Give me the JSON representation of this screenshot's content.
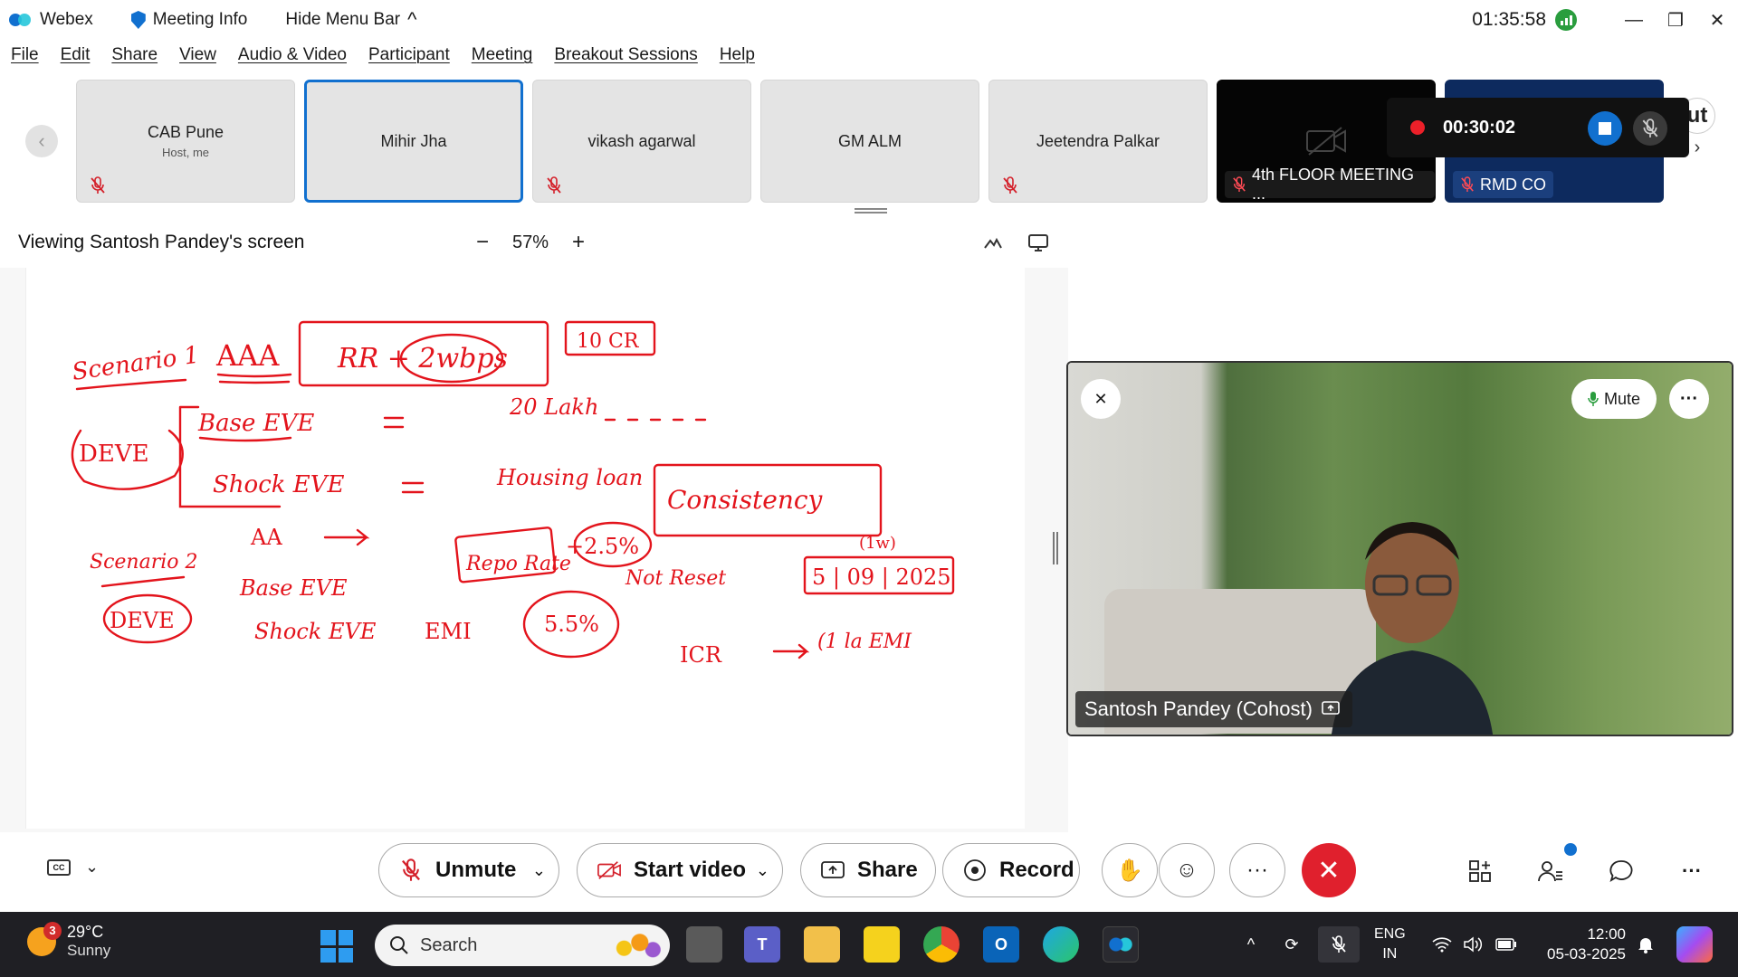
{
  "titlebar": {
    "app_name": "Webex",
    "meeting_info": "Meeting Info",
    "hide_menu": "Hide Menu Bar",
    "hide_menu_caret": "^",
    "clock": "01:35:58",
    "minimize": "—",
    "restore": "❐",
    "close": "✕"
  },
  "menu": [
    "File",
    "Edit",
    "Share",
    "View",
    "Audio & Video",
    "Participant",
    "Meeting",
    "Breakout Sessions",
    "Help"
  ],
  "participants": [
    {
      "name": "CAB Pune",
      "sub": "Host, me"
    },
    {
      "name": "Mihir Jha",
      "sub": ""
    },
    {
      "name": "vikash agarwal",
      "sub": ""
    },
    {
      "name": "GM ALM",
      "sub": ""
    },
    {
      "name": "Jeetendra Palkar",
      "sub": ""
    },
    {
      "name": "4th FLOOR MEETING ...",
      "sub": ""
    },
    {
      "name": "RMD CO",
      "sub": ""
    }
  ],
  "strip_nav": {
    "prev": "‹",
    "next_partial": "ut",
    "next_arrow": "›"
  },
  "recording": {
    "time": "00:30:02"
  },
  "viewing": {
    "title": "Viewing Santosh Pandey's screen",
    "zoom": "57%",
    "zoom_out": "−",
    "zoom_in": "+"
  },
  "video": {
    "name": "Santosh Pandey (Cohost)",
    "mute_label": "Mute",
    "more": "···"
  },
  "controls": {
    "cc": "CC",
    "cc_caret": "⌄",
    "unmute": "Unmute",
    "start_video": "Start video",
    "share": "Share",
    "record": "Record",
    "more": "···",
    "end": "✕",
    "caret": "⌄"
  },
  "taskbar": {
    "weather_badge": "3",
    "temp": "29°C",
    "weather": "Sunny",
    "search": "Search",
    "lang1": "ENG",
    "lang2": "IN",
    "time": "12:00",
    "date": "05-03-2025",
    "tray_up": "^",
    "more": "···"
  },
  "colors": {
    "accent": "#1170cf",
    "end": "#e0202d",
    "ink": "#e3141c",
    "taskbar": "#1f1f24"
  }
}
